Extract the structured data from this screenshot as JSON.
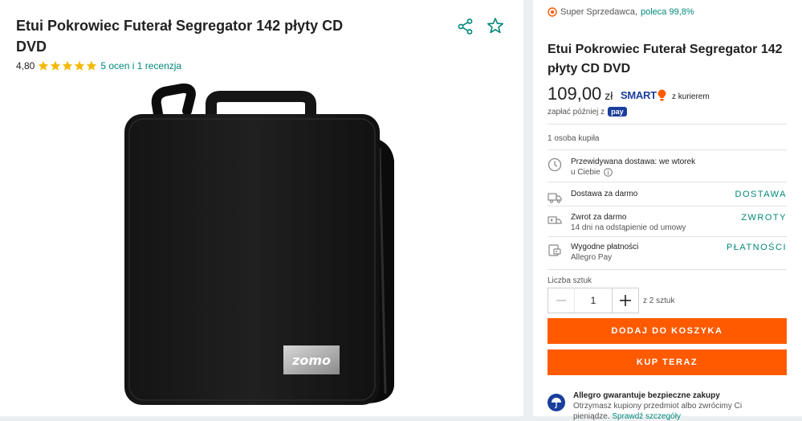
{
  "product": {
    "title": "Etui Pokrowiec Futerał Segregator 142 płyty CD DVD",
    "rating_value": "4,80",
    "rating_stars": 5,
    "rating_link": "5 ocen i 1 recenzja",
    "image_brand": "zomo"
  },
  "seller": {
    "label": "Super Sprzedawca,",
    "recommend": "poleca 99,8%"
  },
  "offer": {
    "title": "Etui Pokrowiec Futerał Segregator 142 płyty CD DVD",
    "price_main": "109,00",
    "price_currency": "zł",
    "smart_label": "SMART",
    "courier": "z kurierem",
    "pay_later": "zapłać później z",
    "pay_badge": "pay",
    "bought": "1 osoba kupiła"
  },
  "delivery": {
    "expected_l1": "Przewidywana dostawa: we wtorek",
    "expected_l2": "u Ciebie",
    "free_delivery": "Dostawa za darmo",
    "free_delivery_link": "DOSTAWA",
    "return_l1": "Zwrot za darmo",
    "return_l2": "14 dni na odstąpienie od umowy",
    "return_link": "ZWROTY",
    "payments_l1": "Wygodne płatności",
    "payments_l2": "Allegro Pay",
    "payments_link": "PŁATNOŚCI"
  },
  "quantity": {
    "label": "Liczba sztuk",
    "value": "1",
    "of": "z 2 sztuk"
  },
  "buttons": {
    "add_to_cart": "DODAJ DO KOSZYKA",
    "buy_now": "KUP TERAZ"
  },
  "guarantee": {
    "title": "Allegro gwarantuje bezpieczne zakupy",
    "line2": "Otrzymasz kupiony przedmiot albo zwrócimy Ci",
    "line3": "pieniądze.",
    "more": "Sprawdź szczegóły"
  },
  "colors": {
    "accent_orange": "#ff5a00",
    "teal": "#00887a",
    "navy": "#1a3e9c",
    "star_yellow": "#f5b800"
  }
}
